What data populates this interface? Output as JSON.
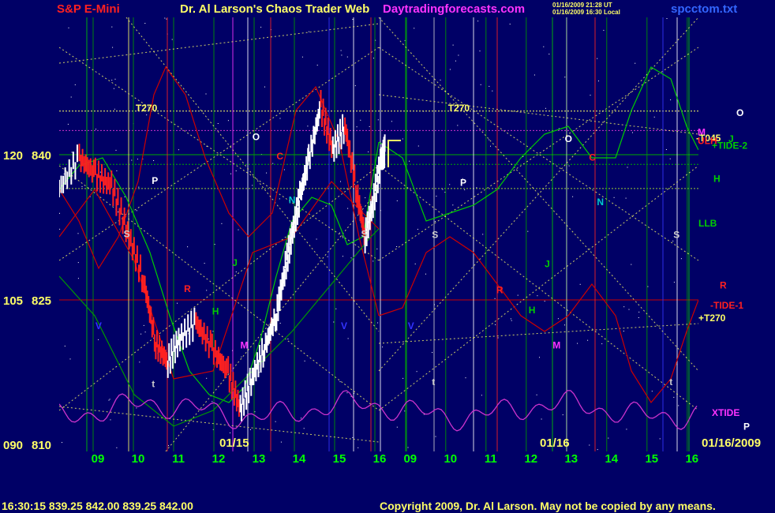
{
  "header": {
    "symbol": "S&P E-Mini",
    "title": "Dr. Al Larson's Chaos Trader Web",
    "site": "Daytradingforecasts.com",
    "stamp_line1": "01/16/2009 21:28 UT",
    "stamp_line2": "01/16/2009 16:30 Local",
    "filename": "spcctom.txt"
  },
  "footer": {
    "quote": "16:30:15  839.25 842.00 839.25 842.00",
    "copyright": "Copyright 2009, Dr. Al Larson. May not be copied by any means."
  },
  "colors": {
    "background": "#000066",
    "price_bar_up": "#ffffff",
    "price_bar_down": "#ff2020",
    "forecast_green": "#00cc00",
    "forecast_red": "#cc0000",
    "xtide": "#cc33cc",
    "grid_green": "#009900",
    "cycle_yellow": "#ffff66"
  },
  "chart_data": {
    "type": "line",
    "title": "S&P E-Mini",
    "y_left_labels": [
      "120",
      "105",
      "090"
    ],
    "y_right_labels": [
      "840",
      "825",
      "810"
    ],
    "ylim": [
      810,
      847
    ],
    "x_hours": [
      "09",
      "10",
      "11",
      "12",
      "13",
      "14",
      "15",
      "16",
      "09",
      "10",
      "11",
      "12",
      "13",
      "14",
      "15",
      "16"
    ],
    "date_labels": [
      "01/15",
      "01/16",
      "01/16/2009"
    ],
    "price_path": [
      {
        "x": 8.0,
        "y": 836.5
      },
      {
        "x": 8.5,
        "y": 839.7
      },
      {
        "x": 8.9,
        "y": 838.0
      },
      {
        "x": 9.3,
        "y": 836.8
      },
      {
        "x": 9.7,
        "y": 832.0
      },
      {
        "x": 10.1,
        "y": 827.0
      },
      {
        "x": 10.4,
        "y": 820.5
      },
      {
        "x": 10.7,
        "y": 818.6
      },
      {
        "x": 11.0,
        "y": 821.0
      },
      {
        "x": 11.4,
        "y": 822.7
      },
      {
        "x": 11.8,
        "y": 820.0
      },
      {
        "x": 12.2,
        "y": 817.5
      },
      {
        "x": 12.5,
        "y": 813.7
      },
      {
        "x": 12.8,
        "y": 817.0
      },
      {
        "x": 13.1,
        "y": 820.0
      },
      {
        "x": 13.4,
        "y": 823.5
      },
      {
        "x": 13.6,
        "y": 828.0
      },
      {
        "x": 13.8,
        "y": 832.0
      },
      {
        "x": 14.0,
        "y": 836.0
      },
      {
        "x": 14.2,
        "y": 839.5
      },
      {
        "x": 14.5,
        "y": 845.0
      },
      {
        "x": 14.8,
        "y": 840.5
      },
      {
        "x": 15.1,
        "y": 843.0
      },
      {
        "x": 15.4,
        "y": 836.0
      },
      {
        "x": 15.6,
        "y": 831.5
      },
      {
        "x": 15.8,
        "y": 835.0
      },
      {
        "x": 16.0,
        "y": 839.5
      },
      {
        "x": 16.1,
        "y": 840.5
      }
    ],
    "markers_day1": [
      {
        "label": "T270",
        "x": 9.9,
        "y": 844.5,
        "color": "#ffff66"
      },
      {
        "label": "P",
        "x": 10.3,
        "y": 837.0,
        "color": "#ffffff"
      },
      {
        "label": "O",
        "x": 12.8,
        "y": 841.5,
        "color": "#ffffff"
      },
      {
        "label": "C",
        "x": 13.4,
        "y": 839.5,
        "color": "#ff2020"
      },
      {
        "label": "N",
        "x": 13.7,
        "y": 835.0,
        "color": "#00cccc"
      },
      {
        "label": "S",
        "x": 9.6,
        "y": 831.5,
        "color": "#cccccc"
      },
      {
        "label": "S",
        "x": 15.5,
        "y": 831.5,
        "color": "#cccccc"
      },
      {
        "label": "R",
        "x": 11.1,
        "y": 825.8,
        "color": "#ff2020"
      },
      {
        "label": "J",
        "x": 12.3,
        "y": 828.5,
        "color": "#00cc00"
      },
      {
        "label": "H",
        "x": 11.8,
        "y": 823.5,
        "color": "#00cc00"
      },
      {
        "label": "M",
        "x": 12.5,
        "y": 820.0,
        "color": "#ff33ff"
      },
      {
        "label": "V",
        "x": 8.9,
        "y": 822.0,
        "color": "#3333ff"
      },
      {
        "label": "V",
        "x": 15.0,
        "y": 822.0,
        "color": "#3333ff"
      },
      {
        "label": "t",
        "x": 10.3,
        "y": 816.0,
        "color": "#cccccc"
      }
    ],
    "markers_day2": [
      {
        "label": "T270",
        "x": 9.9,
        "y": 844.5,
        "color": "#ffff66"
      },
      {
        "label": "P",
        "x": 10.2,
        "y": 836.8,
        "color": "#ffffff"
      },
      {
        "label": "O",
        "x": 12.8,
        "y": 841.3,
        "color": "#ffffff"
      },
      {
        "label": "C",
        "x": 13.4,
        "y": 839.4,
        "color": "#ff2020"
      },
      {
        "label": "N",
        "x": 13.6,
        "y": 834.8,
        "color": "#00cccc"
      },
      {
        "label": "S",
        "x": 9.5,
        "y": 831.4,
        "color": "#cccccc"
      },
      {
        "label": "S",
        "x": 15.5,
        "y": 831.4,
        "color": "#cccccc"
      },
      {
        "label": "R",
        "x": 11.1,
        "y": 825.7,
        "color": "#ff2020"
      },
      {
        "label": "J",
        "x": 12.3,
        "y": 828.4,
        "color": "#00cc00"
      },
      {
        "label": "H",
        "x": 11.9,
        "y": 823.6,
        "color": "#00cc00"
      },
      {
        "label": "M",
        "x": 12.5,
        "y": 820.0,
        "color": "#ff33ff"
      },
      {
        "label": "V",
        "x": 8.9,
        "y": 822.0,
        "color": "#3333ff"
      },
      {
        "label": "t",
        "x": 9.5,
        "y": 816.2,
        "color": "#cccccc"
      },
      {
        "label": "t",
        "x": 15.4,
        "y": 816.2,
        "color": "#cccccc"
      }
    ],
    "right_labels": [
      {
        "label": "O",
        "y": 844.0,
        "color": "#ffffff"
      },
      {
        "label": "M",
        "y": 842.0,
        "color": "#ff33ff"
      },
      {
        "label": "-T045",
        "y": 841.4,
        "color": "#ffff66"
      },
      {
        "label": "ULH",
        "y": 841.1,
        "color": "#ff2020"
      },
      {
        "label": "J",
        "y": 841.3,
        "color": "#00cc00"
      },
      {
        "label": "+TIDE-2",
        "y": 840.6,
        "color": "#00cc00"
      },
      {
        "label": "H",
        "y": 837.2,
        "color": "#00cc00"
      },
      {
        "label": "LLB",
        "y": 832.6,
        "color": "#00cc00"
      },
      {
        "label": "R",
        "y": 826.2,
        "color": "#ff2020"
      },
      {
        "label": "-TIDE-1",
        "y": 824.1,
        "color": "#ff2020"
      },
      {
        "label": "+T270",
        "y": 822.8,
        "color": "#ffff66"
      },
      {
        "label": "XTIDE",
        "y": 813.0,
        "color": "#ff33ff"
      },
      {
        "label": "P",
        "y": 811.6,
        "color": "#ffffff"
      }
    ]
  }
}
